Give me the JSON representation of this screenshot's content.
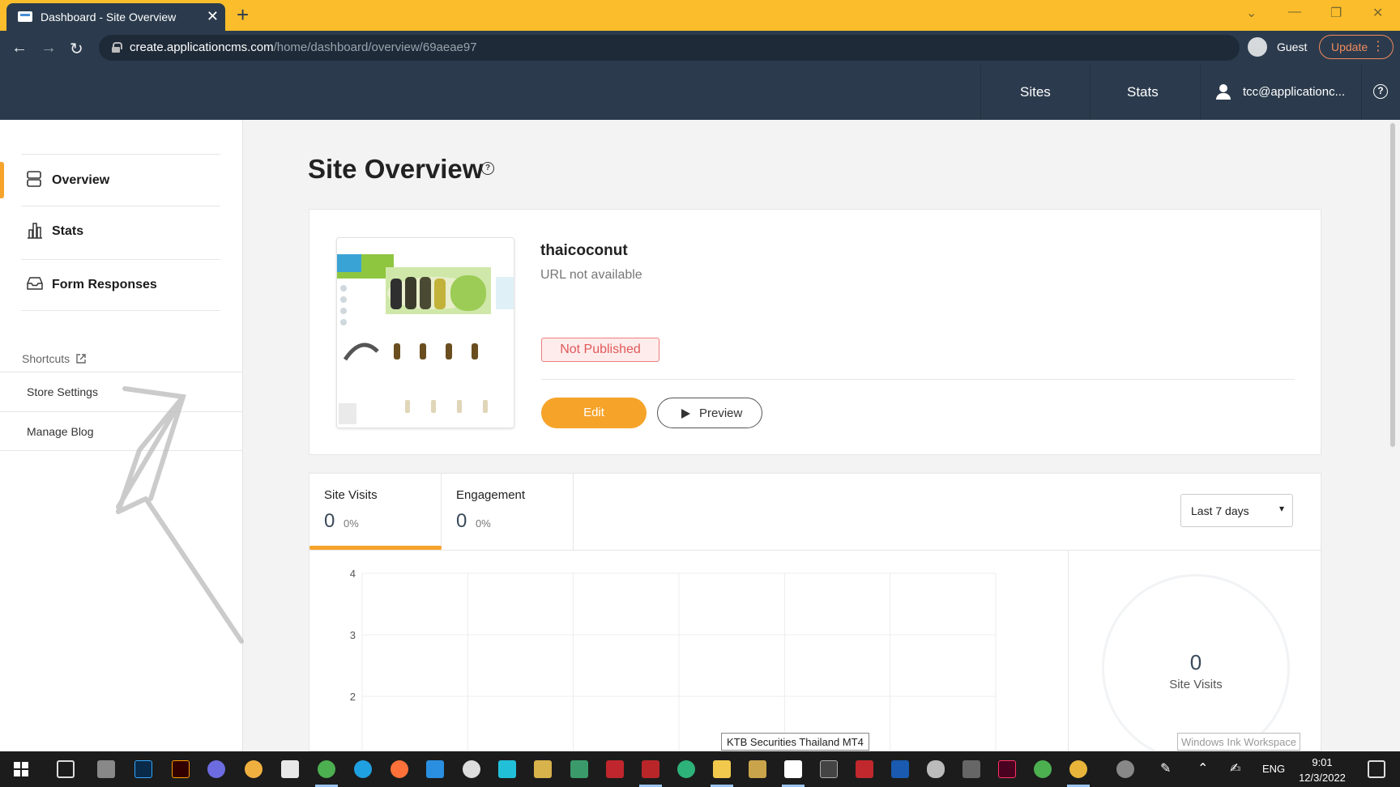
{
  "browser": {
    "tab_title": "Dashboard - Site Overview",
    "url_host": "create.applicationcms.com",
    "url_path": "/home/dashboard/overview/69aeae97",
    "profile_label": "Guest",
    "update_label": "Update"
  },
  "header": {
    "nav": [
      "Sites",
      "Stats"
    ],
    "user_email": "tcc@applicationc...",
    "help_glyph": "?"
  },
  "sidebar": {
    "items": [
      {
        "label": "Overview",
        "icon": "overview-icon",
        "active": true
      },
      {
        "label": "Stats",
        "icon": "bar-chart-icon",
        "active": false
      },
      {
        "label": "Form Responses",
        "icon": "inbox-icon",
        "active": false
      }
    ],
    "shortcuts_label": "Shortcuts",
    "shortcuts": [
      "Store Settings",
      "Manage Blog"
    ]
  },
  "main": {
    "page_title": "Site Overview",
    "title_help_glyph": "?",
    "site": {
      "name": "thaicoconut",
      "url_text": "URL not available",
      "status": "Not Published",
      "edit_label": "Edit",
      "preview_label": "Preview"
    },
    "stats": {
      "tabs": [
        {
          "label": "Site Visits",
          "value": "0",
          "pct": "0%",
          "active": true
        },
        {
          "label": "Engagement",
          "value": "0",
          "pct": "0%",
          "active": false
        }
      ],
      "range_selected": "Last 7 days",
      "summary_value": "0",
      "summary_label": "Site Visits"
    }
  },
  "chart_data": {
    "type": "line",
    "title": "",
    "xlabel": "",
    "ylabel": "",
    "y_ticks_visible": [
      "4",
      "3",
      "2"
    ],
    "ylim": [
      0,
      4
    ],
    "grid": true,
    "series": [
      {
        "values": [
          0,
          0,
          0,
          0,
          0,
          0,
          0
        ]
      }
    ],
    "color": "#f6a32a"
  },
  "overlays": {
    "tooltip": "KTB Securities Thailand MT4",
    "ink_workspace": "Windows Ink Workspace"
  },
  "taskbar": {
    "language": "ENG",
    "time": "9:01",
    "date": "12/3/2022"
  },
  "colors": {
    "accent": "#f6a32a",
    "header_bg": "#2b3b4d",
    "tab_strip": "#fbbd2b",
    "status_red": "#e0595b"
  }
}
